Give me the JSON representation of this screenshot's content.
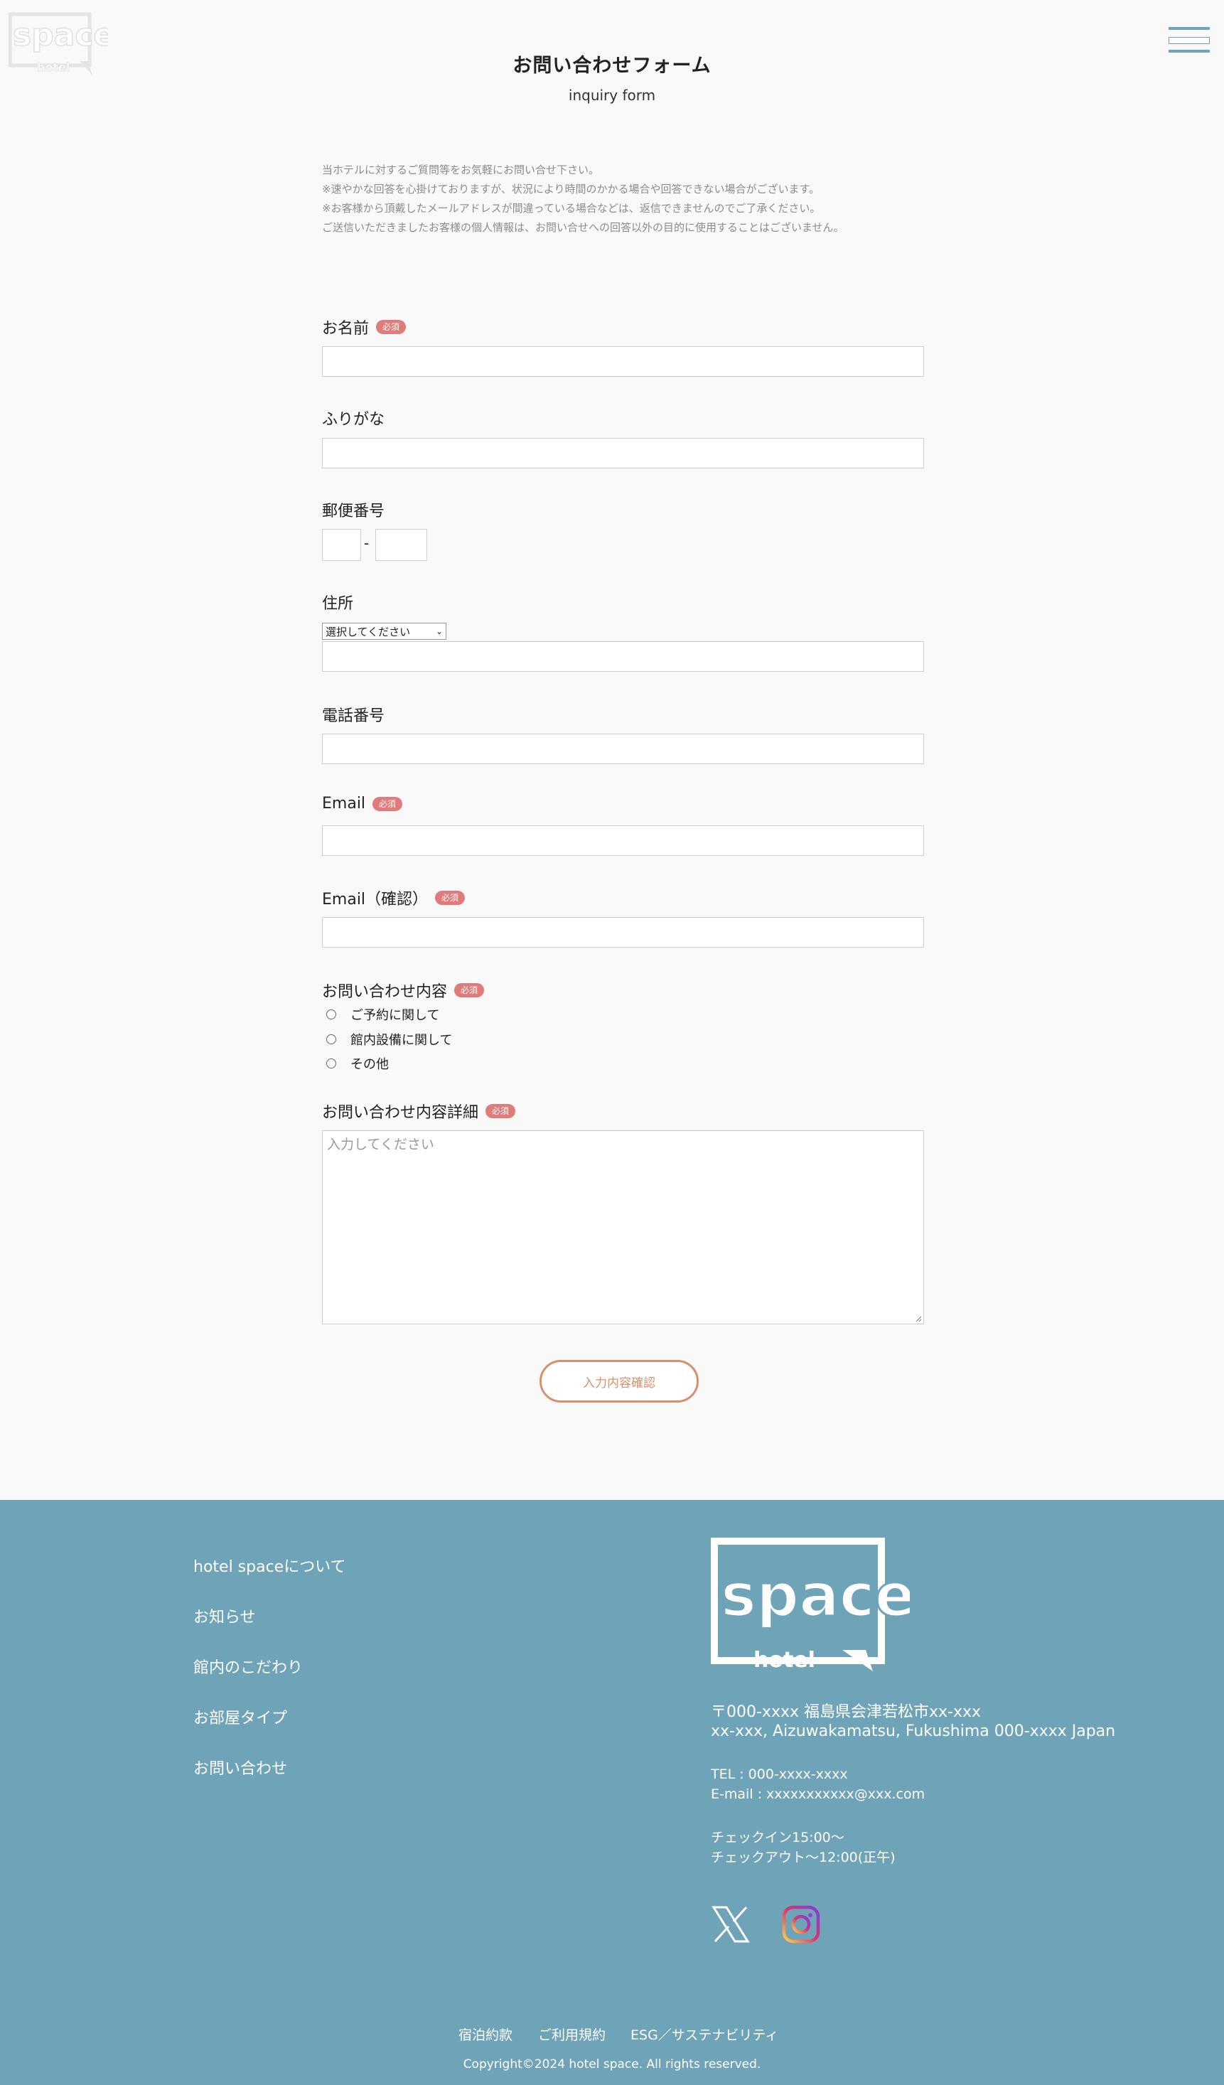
{
  "header": {
    "logo_word": "space",
    "logo_sub": "hotel",
    "title": "お問い合わせフォーム",
    "subtitle": "inquiry form"
  },
  "intro": [
    "当ホテルに対するご質問等をお気軽にお問い合せ下さい。",
    "※速やかな回答を心掛けておりますが、状況により時間のかかる場合や回答できない場合がございます。",
    "※お客様から頂戴したメールアドレスが間違っている場合などは、返信できませんのでご了承ください。",
    "ご送信いただきましたお客様の個人情報は、お問い合せへの回答以外の目的に使用することはございません。"
  ],
  "required_badge": "必須",
  "form": {
    "name_label": "お名前",
    "kana_label": "ふりがな",
    "zip_label": "郵便番号",
    "zip_sep": "-",
    "address_label": "住所",
    "prefecture_select": "選択してください",
    "phone_label": "電話番号",
    "email_label": "Email",
    "email_confirm_label": "Email（確認）",
    "inquiry_type_label": "お問い合わせ内容",
    "inquiry_options": [
      "ご予約に関して",
      "館内設備に関して",
      "その他"
    ],
    "detail_label": "お問い合わせ内容詳細",
    "detail_placeholder": "入力してください",
    "submit_label": "入力内容確認"
  },
  "footer": {
    "nav": [
      "hotel spaceについて",
      "お知らせ",
      "館内のこだわり",
      "お部屋タイプ",
      "お問い合わせ"
    ],
    "address_jp": "〒000-xxxx 福島県会津若松市xx-xxx",
    "address_en": "xx-xxx, Aizuwakamatsu, Fukushima 000-xxxx Japan",
    "tel": "TEL : 000-xxxx-xxxx",
    "email": "E-mail : xxxxxxxxxxx@xxx.com",
    "checkin": "チェックイン15:00〜",
    "checkout": "チェックアウト〜12:00(正午)",
    "social": [
      "x-icon",
      "instagram-icon"
    ],
    "bottom_links": [
      "宿泊約款",
      "ご利用規約",
      "ESG／サステナビリティ"
    ],
    "copyright": "Copyright©2024 hotel space. All rights reserved."
  },
  "colors": {
    "accent_blue": "#6fa4b8",
    "badge_red": "#e07b7b",
    "button_orange": "#d8906c"
  }
}
